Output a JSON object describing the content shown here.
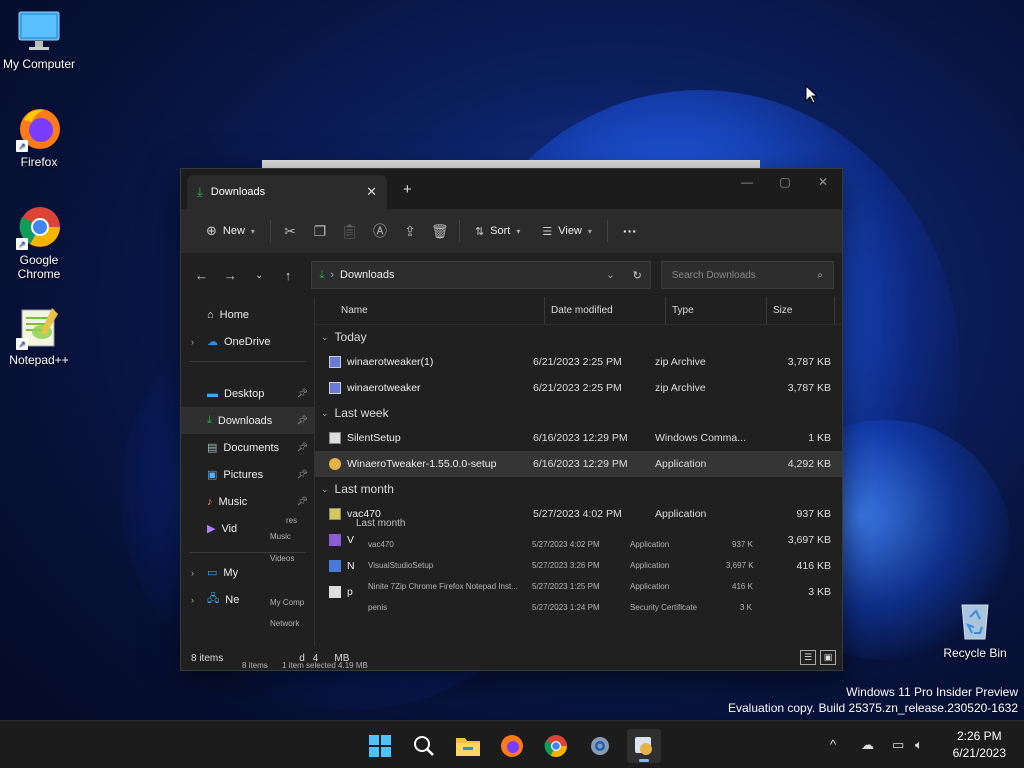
{
  "desktop": {
    "icons": [
      {
        "label": "My Computer",
        "icon": "monitor-icon"
      },
      {
        "label": "Firefox",
        "icon": "firefox-icon"
      },
      {
        "label": "Google Chrome",
        "icon": "chrome-icon"
      },
      {
        "label": "Notepad++",
        "icon": "notepadpp-icon"
      },
      {
        "label": "Recycle Bin",
        "icon": "recycle-bin-icon"
      }
    ],
    "watermark_line1": "Windows 11 Pro Insider Preview",
    "watermark_line2": "Evaluation copy. Build 25375.zn_release.230520-1632"
  },
  "explorer": {
    "tab_title": "Downloads",
    "new_tab": "+",
    "toolbar": {
      "new_label": "New",
      "sort_label": "Sort",
      "view_label": "View",
      "more_label": "···"
    },
    "address": "Downloads",
    "search_placeholder": "Search Downloads",
    "nav": {
      "home": "Home",
      "onedrive": "OneDrive",
      "desktop": "Desktop",
      "downloads": "Downloads",
      "documents": "Documents",
      "pictures": "Pictures",
      "music": "Music",
      "videos": "Vid",
      "mypc": "My",
      "network": "Ne"
    },
    "columns": {
      "name": "Name",
      "date": "Date modified",
      "type": "Type",
      "size": "Size"
    },
    "groups": {
      "today": "Today",
      "last_week": "Last week",
      "last_month": "Last month"
    },
    "rows": [
      {
        "name": "winaerotweaker(1)",
        "date": "6/21/2023 2:25 PM",
        "type": "zip Archive",
        "size": "3,787 KB"
      },
      {
        "name": "winaerotweaker",
        "date": "6/21/2023 2:25 PM",
        "type": "zip Archive",
        "size": "3,787 KB"
      },
      {
        "name": "SilentSetup",
        "date": "6/16/2023 12:29 PM",
        "type": "Windows Comma...",
        "size": "1 KB"
      },
      {
        "name": "WinaeroTweaker-1.55.0.0-setup",
        "date": "6/16/2023 12:29 PM",
        "type": "Application",
        "size": "4,292 KB"
      },
      {
        "name": "vac470",
        "date": "5/27/2023 4:02 PM",
        "type": "Application",
        "size": "937 KB"
      }
    ],
    "partial_rows": [
      {
        "name": "V",
        "size": "3,697 KB"
      },
      {
        "name": "N",
        "size": "416 KB"
      },
      {
        "name": "p",
        "size": "3 KB"
      }
    ],
    "status": {
      "items": "8 items",
      "partial1": "d",
      "partial2": "4",
      "partial3": "MB"
    }
  },
  "ghost": {
    "group": "Last month",
    "nav": [
      "Music",
      "Videos",
      "My Comp",
      "Network"
    ],
    "rows": [
      {
        "name": "vac470",
        "date": "5/27/2023 4:02 PM",
        "type": "Application",
        "size": "937 K"
      },
      {
        "name": "VisualStudioSetup",
        "date": "5/27/2023 3:26 PM",
        "type": "Application",
        "size": "3,697 K"
      },
      {
        "name": "Ninite 7Zip Chrome Firefox Notepad Inst...",
        "date": "5/27/2023 1:25 PM",
        "type": "Application",
        "size": "416 K"
      },
      {
        "name": "penis",
        "date": "5/27/2023 1:24 PM",
        "type": "Security Certificate",
        "size": "3 K"
      }
    ],
    "status_items": "8 items",
    "status_sel": "1 item selected  4.19 MB",
    "nav_partial": "res"
  },
  "taskbar": {
    "time": "2:26 PM",
    "date": "6/21/2023",
    "chevron": "^"
  },
  "colors": {
    "accent": "#0078d4",
    "folder": "#f3c13a",
    "download_green": "#2fb344"
  }
}
